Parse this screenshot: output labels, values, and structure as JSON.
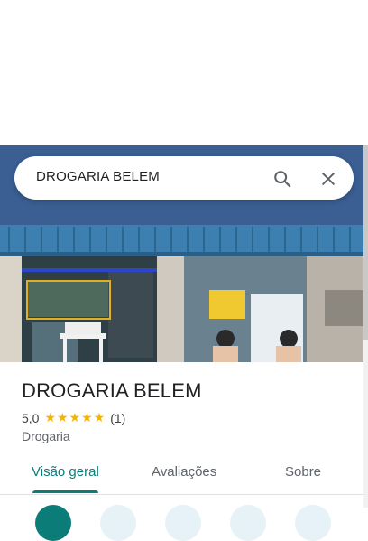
{
  "search": {
    "query": "DROGARIA BELEM",
    "search_icon": "search-icon",
    "close_icon": "close-icon"
  },
  "place": {
    "name": "DROGARIA BELEM",
    "rating": "5,0",
    "stars": "★★★★★",
    "review_count": "(1)",
    "category": "Drogaria"
  },
  "tabs": [
    {
      "label": "Visão geral",
      "active": true
    },
    {
      "label": "Avaliações",
      "active": false
    },
    {
      "label": "Sobre",
      "active": false
    }
  ],
  "colors": {
    "accent": "#0b7c78",
    "star": "#f4b400",
    "awning": "#3d7fb0"
  }
}
